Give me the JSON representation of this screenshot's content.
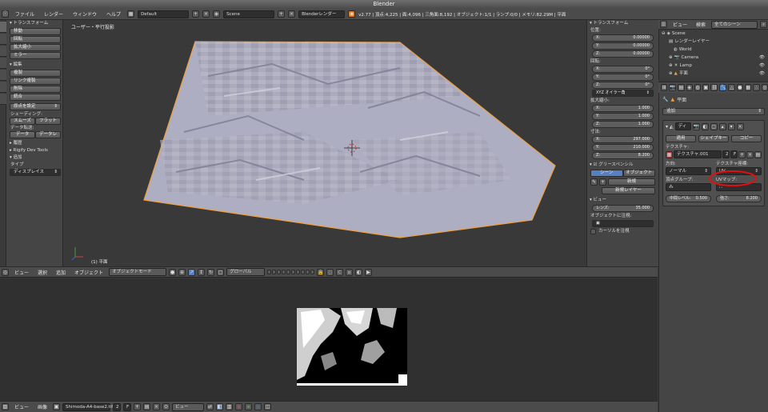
{
  "title": "Blender",
  "topbar": {
    "menus": [
      "ファイル",
      "レンダー",
      "ウィンドウ",
      "ヘルプ"
    ],
    "screen_layout": "Default",
    "scene": "Scene",
    "render_engine": "Blenderレンダー",
    "stats": "v2.77 | 頂点:4,225 | 面:4,096 | 三角面:8,192 | オブジェクト:1/1 | ランプ:0/0 | メモリ:82.29M | 平面"
  },
  "toolshelf": {
    "transform_header": "トランスフォーム",
    "transform_buttons": [
      "移動",
      "回転",
      "拡大縮小",
      "ミラー"
    ],
    "edit_header": "編集",
    "edit_buttons": [
      "複製",
      "リンク複製",
      "削除",
      "統合"
    ],
    "origin_select": "原点を設定",
    "shading_label": "シェーディング:",
    "shading_buttons": [
      "スムーズ",
      "フラット"
    ],
    "data_transfer_label": "データ転送:",
    "data_transfer_buttons": [
      "データ",
      "データレ"
    ],
    "history_header": "履歴",
    "rigify_header": "Rigify Dev Tools",
    "add_header": "追加",
    "type_label": "タイプ",
    "type_value": "ディスプレイス",
    "vtabs": [
      "ツール",
      "作成",
      "関係",
      "アニメーション",
      "物理演算",
      "グリースペンシル",
      "Ivy"
    ]
  },
  "viewport": {
    "label": "ユーザー・平行投影",
    "object_label": "(1) 平面"
  },
  "props3d": {
    "transform_header": "トランスフォーム",
    "location_label": "位置:",
    "location": [
      "0.00000",
      "0.00000",
      "0.00000"
    ],
    "rotation_label": "回転:",
    "rotation": [
      "0°",
      "0°",
      "0°"
    ],
    "rotation_mode": "XYZ オイラー角",
    "scale_label": "拡大縮小:",
    "scale": [
      "1.000",
      "1.000",
      "1.000"
    ],
    "dimensions_label": "寸法:",
    "dimensions": [
      "297.000",
      "210.000",
      "8.200"
    ],
    "axis_labels": [
      "X:",
      "Y:",
      "Z:"
    ],
    "grease_header": "グリースペンシル",
    "grease_tabs": [
      "シーン",
      "オブジェクト"
    ],
    "grease_new": "新規",
    "grease_new_layer": "新規レイヤー",
    "view_header": "ビュー",
    "lens_label": "レンズ:",
    "lens_value": "35.000",
    "lock_to_object": "オブジェクトに注視:",
    "lock_cursor": "カーソルを注視"
  },
  "header3d": {
    "menus": [
      "ビュー",
      "選択",
      "追加",
      "オブジェクト"
    ],
    "mode": "オブジェクトモード",
    "orientation": "グローバル"
  },
  "image_editor_header": {
    "menus": [
      "ビュー",
      "画像"
    ],
    "image_name": "Shimoda-A4-base2.tif",
    "users": "2",
    "fake": "F",
    "view_mode": "ビュー"
  },
  "outliner": {
    "header_menus": [
      "ビュー",
      "検索"
    ],
    "filter": "全てのシーン",
    "items": [
      {
        "name": "Scene",
        "indent": 0
      },
      {
        "name": "レンダーレイヤー",
        "indent": 1
      },
      {
        "name": "World",
        "indent": 1
      },
      {
        "name": "Camera",
        "indent": 1
      },
      {
        "name": "Lamp",
        "indent": 1
      },
      {
        "name": "平面",
        "indent": 1
      }
    ]
  },
  "properties": {
    "breadcrumb": "平面",
    "add_menu": "追加",
    "texture_slot": "ディ",
    "tabs": [
      "適用",
      "シェイプキー",
      "コピー"
    ],
    "texture_label": "テクスチャ:",
    "texture_name": "テクスチャ.001",
    "texture_users": "2",
    "texture_fake": "F",
    "direction_label": "方向:",
    "direction_value": "ノーマル",
    "tex_coords_label": "テクスチャ座標:",
    "tex_coords_value": "UV",
    "vertex_group_label": "頂点グループ:",
    "uv_map_label": "UVマップ:",
    "midlevel_label": "中間レベル:",
    "midlevel_value": "0.500",
    "strength_label": "強さ:",
    "strength_value": "8.200",
    "highlight_color": "#e01010"
  },
  "colors": {
    "accent_blue": "#5680c2",
    "selection_orange": "#f0a040"
  }
}
